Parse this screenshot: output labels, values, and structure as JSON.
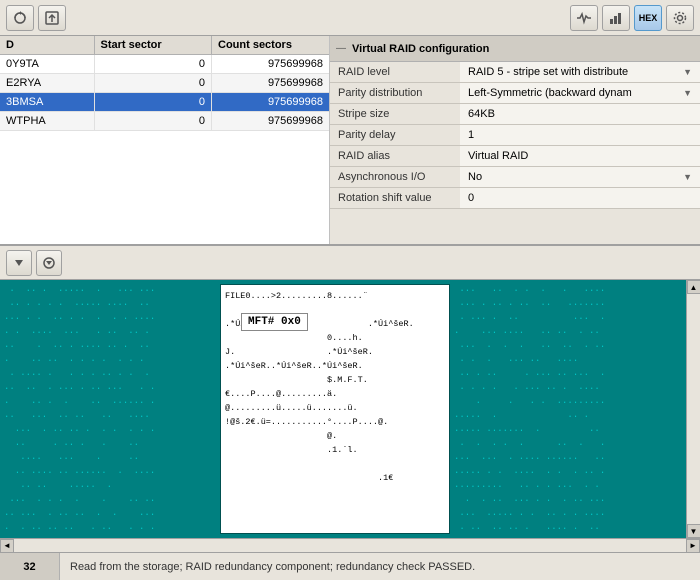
{
  "toolbar": {
    "left_buttons": [
      {
        "id": "refresh",
        "icon": "↺",
        "label": "Refresh"
      },
      {
        "id": "export",
        "icon": "⬆",
        "label": "Export"
      }
    ],
    "right_buttons": [
      {
        "id": "pulse",
        "icon": "♥",
        "label": "Pulse"
      },
      {
        "id": "chart",
        "icon": "📊",
        "label": "Chart"
      },
      {
        "id": "hex",
        "icon": "HEX",
        "label": "Hex View"
      },
      {
        "id": "settings",
        "icon": "⚙",
        "label": "Settings"
      }
    ]
  },
  "disk_table": {
    "columns": [
      "D",
      "Start sector",
      "Count sectors"
    ],
    "rows": [
      {
        "id": "0Y9TA",
        "start": "0",
        "count": "975699968"
      },
      {
        "id": "E2RYA",
        "start": "0",
        "count": "975699968"
      },
      {
        "id": "3BMSA",
        "start": "0",
        "count": "975699968",
        "selected": true
      },
      {
        "id": "WTPHA",
        "start": "0",
        "count": "975699968"
      }
    ]
  },
  "raid_config": {
    "header": "Virtual RAID configuration",
    "fields": [
      {
        "label": "RAID level",
        "value": "RAID 5 - stripe set with distribute",
        "has_dropdown": true
      },
      {
        "label": "Parity distribution",
        "value": "Left-Symmetric (backward dynam",
        "has_dropdown": true
      },
      {
        "label": "Stripe size",
        "value": "64KB",
        "has_dropdown": false
      },
      {
        "label": "Parity delay",
        "value": "1",
        "has_dropdown": false
      },
      {
        "label": "RAID alias",
        "value": "Virtual RAID",
        "has_dropdown": false
      },
      {
        "label": "Asynchronous I/O",
        "value": "No",
        "has_dropdown": true
      },
      {
        "label": "Rotation shift value",
        "value": "0",
        "has_dropdown": false
      }
    ]
  },
  "mid_toolbar": {
    "buttons": [
      {
        "id": "dropdown1",
        "icon": "▼",
        "label": "Dropdown 1"
      },
      {
        "id": "dropdown2",
        "icon": "▼",
        "label": "Dropdown 2"
      }
    ]
  },
  "hex_view": {
    "highlight_text": "MFT# 0x0",
    "lines": [
      "FILE0....>2.........8......¨",
      "                                    ",
      ".*Úi^šeR.*                  .*Úi^šeR.",
      "                    0....h.",
      "J.                  .*Úi^šeR.",
      ".*Úi^šeR..*Úi^šeR..*Úi^šeR.",
      "                    $.M.F.T.",
      "€....P....@.........ä.",
      "@.........ü.....ü.......ü.",
      "!@š.2€.ü=...........°....P....@.",
      "                    @.",
      "                    .1.`l.",
      "                              ",
      "                              .1€"
    ],
    "dots_pattern": "·"
  },
  "status_bar": {
    "sector_number": "32",
    "message": "Read from the storage; RAID redundancy component; redundancy check PASSED."
  }
}
